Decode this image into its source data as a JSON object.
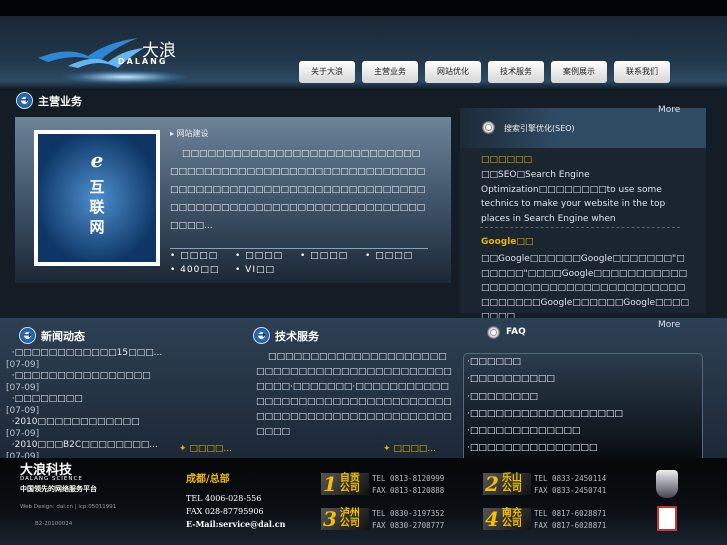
{
  "header": {
    "logo_cn": "大浪",
    "logo_en": "DALANG"
  },
  "nav": [
    "关于大浪",
    "主营业务",
    "网站优化",
    "技术服务",
    "案例展示",
    "联系我们"
  ],
  "main": {
    "title": "主营业务",
    "image_text": [
      "e",
      "互",
      "联",
      "网"
    ],
    "sub_title": "网站建设",
    "paragraph": "□□□□□□□□□□□□□□□□□□□□□□□□□□□□□□□□□□□□□□□□□□□□□□□□□□□□□□□□□□□□□□□□□□□□□□□□□□□□□□□□□□□□□□□□□□□□□□□□□□□□□□□□□□□□□□□□□□□□□□□□□□...",
    "links": [
      "□□□□",
      "□□□□",
      "□□□□",
      "□□□□",
      "400□□",
      "VI□□"
    ]
  },
  "seo": {
    "more": "More",
    "title": "搜索引擎优化(SEO)",
    "item1_title": "□□□□□□",
    "item1_text": "□□SEO□Search Engine Optimization□□□□□□□□to use some technics to make your website in the top places in Search Engine when",
    "item2_title": "Google□□",
    "item2_text": "□□Google□□□□□□Google□□□□□□□\"□□□□□□\"□□□□Google□□□□□□□□□□□□□□□□□□□□□□□□□□□□□□□□□□□□□□□□□□Google□□□□□□Google□□□□□□□□"
  },
  "news": {
    "title": "新闻动态",
    "items": [
      {
        "text": "□□□□□□□□□□□□15□□□...",
        "date": "[07-09]"
      },
      {
        "text": "□□□□□□□□□□□□□□□□",
        "date": "[07-09]"
      },
      {
        "text": "□□□□□□□□",
        "date": "[07-09]"
      },
      {
        "text": "2010□□□□□□□□□□□□",
        "date": "[07-09]"
      },
      {
        "text": "2010□□□B2C□□□□□□□□...",
        "date": "[07-09]"
      }
    ],
    "more": "□□□□..."
  },
  "tech": {
    "title": "技术服务",
    "text": "□□□□□□□□□□□□□□□□□□□□□□□□□□□□□□□□□□□□□□□□□□□□□□□□·□□□□□□□·□□□□□□□□□□□□□□□□□□□□□□□□□□□□□□□□□□□□□□□□□□□□□□□□□□□□□□□□□□□□□",
    "more": "□□□□..."
  },
  "faq": {
    "title": "FAQ",
    "more": "More",
    "items": [
      "□□□□□□",
      "□□□□□□□□□□",
      "□□□□□□□□",
      "□□□□□□□□□□□□□□□□□□",
      "□□□□□□□□□□□□□",
      "□□□□□□□□□□□□□□□"
    ]
  },
  "footer": {
    "brand_cn": "大浪科技",
    "brand_en": "DALANG SCIENCE",
    "slogan": "中国领先的网络服务平台",
    "design": "Web Design: dal.cn | icp:05011991",
    "icp2": "B2-20100024",
    "hq": "成都/总部",
    "tel": "TEL  4006-028-556",
    "fax": "FAX  028-87795906",
    "email": "E-Mail:service@dal.cn",
    "branches": [
      {
        "num": "1",
        "city": "自贡",
        "co": "公司",
        "tel": "TEL 0813-8120999",
        "fax": "FAX 0813-8120888"
      },
      {
        "num": "2",
        "city": "乐山",
        "co": "公司",
        "tel": "TEL 0833-2450114",
        "fax": "FAX 0833-2450741"
      },
      {
        "num": "3",
        "city": "泸州",
        "co": "公司",
        "tel": "TEL 0830-3197352",
        "fax": "FAX 0830-2708777"
      },
      {
        "num": "4",
        "city": "南充",
        "co": "公司",
        "tel": "TEL 0817-6028871",
        "fax": "FAX 0817-6028871"
      }
    ]
  }
}
